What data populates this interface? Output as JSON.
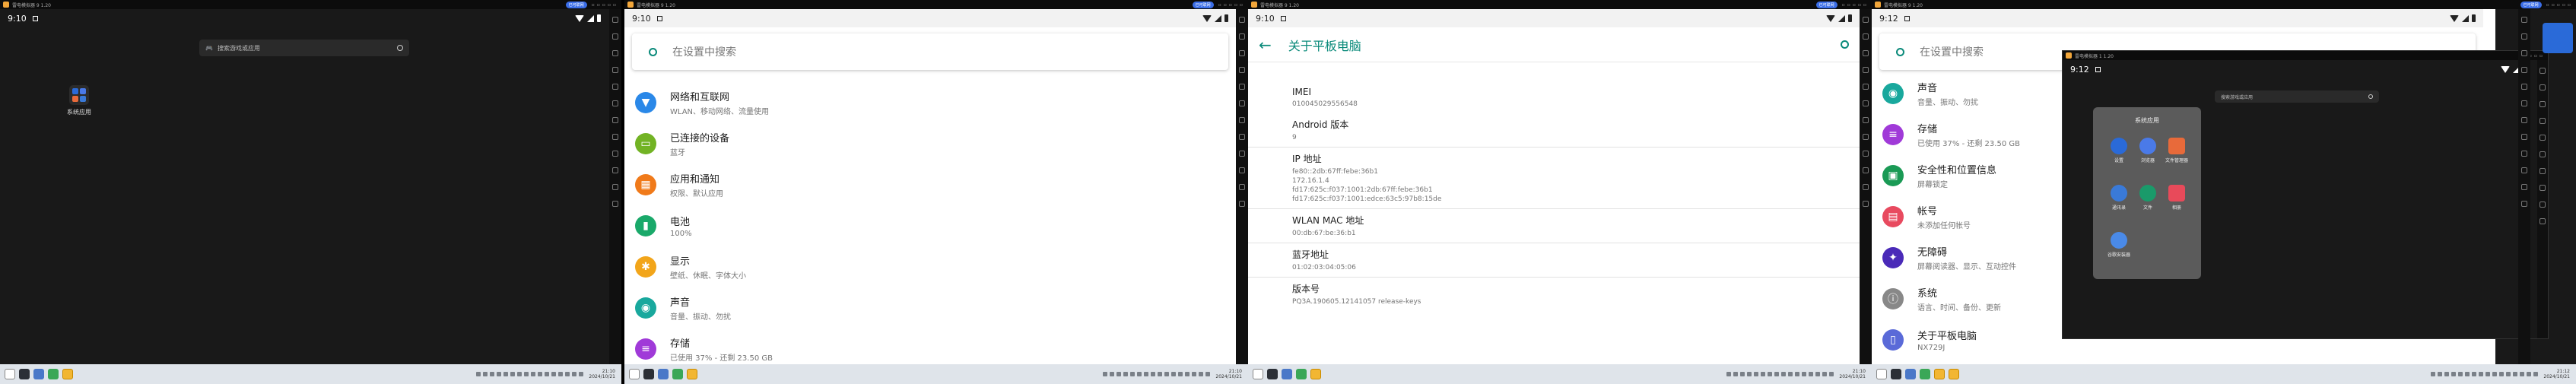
{
  "emulator": {
    "title": "雷电模拟器 9 1.20",
    "pill": "已可联网",
    "inner_title": "雷电模拟器 1 1.20"
  },
  "panel1": {
    "time": "9:10",
    "search_placeholder": "搜索游戏或应用",
    "app_folder_label": "系统应用"
  },
  "panel2": {
    "time": "9:10",
    "search_placeholder": "在设置中搜索",
    "items": [
      {
        "title": "网络和互联网",
        "subtitle": "WLAN、移动网络、流量使用",
        "color": "#2a88e8",
        "glyph": "▼"
      },
      {
        "title": "已连接的设备",
        "subtitle": "蓝牙",
        "color": "#72b324",
        "glyph": "▭"
      },
      {
        "title": "应用和通知",
        "subtitle": "权限、默认应用",
        "color": "#f07a1a",
        "glyph": "▦"
      },
      {
        "title": "电池",
        "subtitle": "100%",
        "color": "#1aa96a",
        "glyph": "▮"
      },
      {
        "title": "显示",
        "subtitle": "壁纸、休眠、字体大小",
        "color": "#f2a51a",
        "glyph": "✱"
      },
      {
        "title": "声音",
        "subtitle": "音量、振动、勿扰",
        "color": "#19a89d",
        "glyph": "◉"
      },
      {
        "title": "存储",
        "subtitle": "已使用 37% - 还剩 23.50 GB",
        "color": "#a03ad8",
        "glyph": "≡"
      }
    ]
  },
  "panel3": {
    "time": "9:10",
    "header_title": "关于平板电脑",
    "items": [
      {
        "title": "IMEI",
        "value": "010045029556548"
      },
      {
        "title": "Android 版本",
        "value": "9"
      },
      {
        "title": "IP 地址",
        "value": "fe80::2db:67ff:febe:36b1\n172.16.1.4\nfd17:625c:f037:1001:2db:67ff:febe:36b1\nfd17:625c:f037:1001:edce:63c5:97b8:15de"
      },
      {
        "title": "WLAN MAC 地址",
        "value": "00:db:67:be:36:b1"
      },
      {
        "title": "蓝牙地址",
        "value": "01:02:03:04:05:06"
      },
      {
        "title": "版本号",
        "value": "PQ3A.190605.12141057 release-keys"
      }
    ]
  },
  "panel4": {
    "time": "9:12",
    "search_placeholder": "在设置中搜索",
    "items": [
      {
        "title": "声音",
        "subtitle": "音量、振动、勿扰",
        "color": "#19a89d",
        "glyph": "◉"
      },
      {
        "title": "存储",
        "subtitle": "已使用 37% - 还剩 23.50 GB",
        "color": "#a03ad8",
        "glyph": "≡"
      },
      {
        "title": "安全性和位置信息",
        "subtitle": "屏幕锁定",
        "color": "#1a9a55",
        "glyph": "▣"
      },
      {
        "title": "帐号",
        "subtitle": "未添加任何帐号",
        "color": "#e84a5f",
        "glyph": "▤"
      },
      {
        "title": "无障碍",
        "subtitle": "屏幕阅读器、显示、互动控件",
        "color": "#4a2ab8",
        "glyph": "✦"
      },
      {
        "title": "系统",
        "subtitle": "语言、时间、备份、更新",
        "color": "#888888",
        "glyph": "ⓘ"
      },
      {
        "title": "关于平板电脑",
        "subtitle": "NX729J",
        "color": "#5a6ad8",
        "glyph": "▯"
      }
    ],
    "inner": {
      "time": "9:12",
      "search_placeholder": "搜索游戏或应用",
      "folder_title": "系统应用",
      "apps": [
        {
          "label": "设置",
          "color": "#2a6ad8"
        },
        {
          "label": "浏览器",
          "color": "#4a7ae8"
        },
        {
          "label": "文件管理器",
          "color": "#e86a3a"
        },
        {
          "label": "通讯录",
          "color": "#3a7ad8"
        },
        {
          "label": "文件",
          "color": "#1a9a6a"
        },
        {
          "label": "相册",
          "color": "#e84a5a"
        },
        {
          "label": "谷歌安装器",
          "color": "#4a8ae8"
        }
      ]
    }
  },
  "taskbar": [
    {
      "time": "21:10",
      "date": "2024/10/21"
    },
    {
      "time": "21:10",
      "date": "2024/10/21"
    },
    {
      "time": "21:10",
      "date": "2024/10/21"
    },
    {
      "time": "21:12",
      "date": "2024/10/21"
    }
  ]
}
